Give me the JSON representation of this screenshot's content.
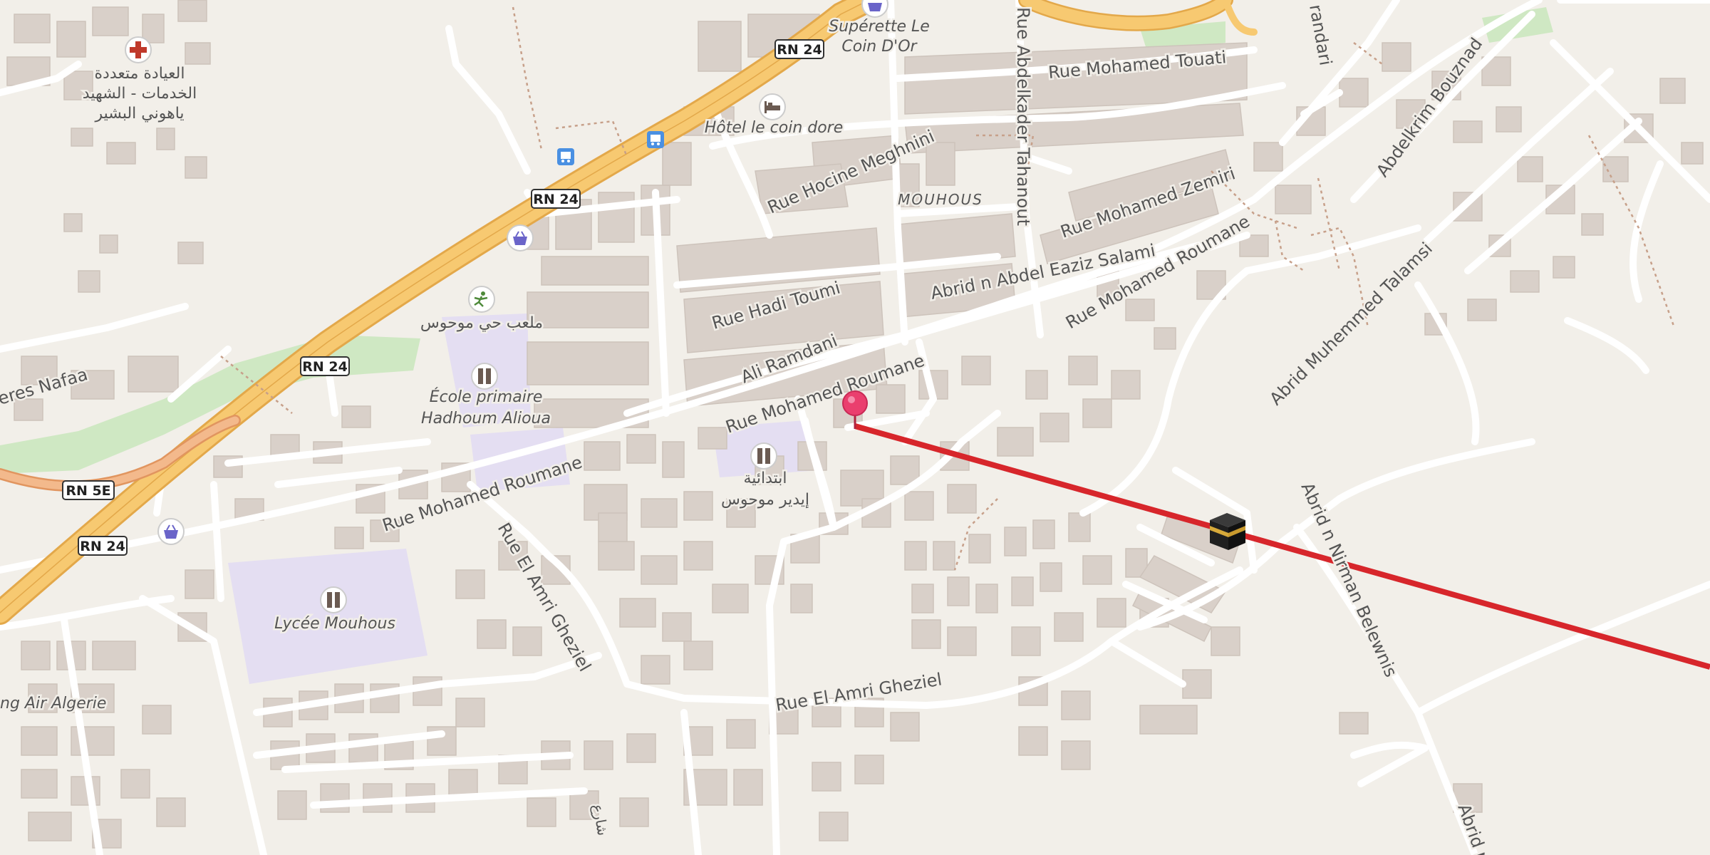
{
  "map": {
    "background": "#f2efe9",
    "colors": {
      "building": "#d9d0c9",
      "road_minor": "#ffffff",
      "road_major": "#f7c971",
      "road_major_edge": "#e3a84a",
      "ramp": "#f3b98c",
      "school_area": "#e4def2",
      "park": "#cfe8c3",
      "route_line": "#d7262b",
      "pin": "#ea3f6e",
      "shop_icon": "#6a64c9",
      "bus_icon": "#4a90e2",
      "hospital_icon": "#c0392b",
      "poi_icon_bg": "#7b6f66"
    },
    "streets": {
      "rue_mohamed_touati": "Rue Mohamed Touati",
      "rue_hocine_meghnini": "Rue Hocine Meghnini",
      "rue_abdelkader_tahanout": "Rue Abdelkader Tahanout",
      "rue_mohamed_zemiri": "Rue Mohamed Zemiri",
      "abrid_abdel_eaziz": "Abrid n Abdel Eaziz Salami",
      "rue_mohamed_roumane_ne": "Rue Mohamed Roumane",
      "rue_hadi_toumi": "Rue Hadi Toumi",
      "ali_ramdani": "Ali Ramdani",
      "rue_mohamed_roumane_mid": "Rue Mohamed Roumane",
      "rue_mohamed_roumane_sw": "Rue Mohamed Roumane",
      "rue_el_amri_gheziel_diag": "Rue El Amri Gheziel",
      "rue_el_amri_gheziel": "Rue El Amri Gheziel",
      "abdelkrim_bouznad": "Abdelkrim Bouznad",
      "abrid_muhemmed": "Abrid Muhemmed Talamsi",
      "abrid_nirman": "Abrid n Nirman Belewnis",
      "abrid_edge": "Abrid n",
      "randari": "randari",
      "freres_nafaa": "eres Nafaa",
      "air_algerie": "ng Air Algerie",
      "arabic_street": "شارع"
    },
    "road_shields": [
      "RN 24",
      "RN 24",
      "RN 24",
      "RN 5E",
      "RN 24"
    ],
    "places": {
      "mouhous": "MOUHOUS",
      "superette": [
        "Supérette Le",
        "Coin D'Or"
      ],
      "hotel": "Hôtel le coin dore",
      "clinic": [
        "العيادة متعددة",
        "الخدمات - الشهيد",
        "ياهوني البشير"
      ],
      "playground": "ملعب حي موحوس",
      "ecole": [
        "École primaire",
        "Hadhoum Alioua"
      ],
      "ibtidaiya": [
        "ابتدائية",
        "إيدير موحوس"
      ],
      "lycee": "Lycée Mouhous"
    },
    "icons": {
      "pin": "location-pin",
      "kaaba": "kaaba-qibla-marker",
      "hospital": "hospital-cross",
      "hotel": "bed",
      "shop": "shopping-basket",
      "bus": "bus-stop",
      "school": "school",
      "sport": "playground"
    }
  }
}
